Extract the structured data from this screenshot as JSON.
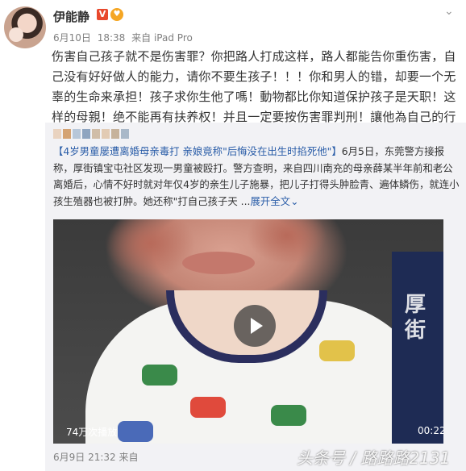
{
  "author": {
    "name": "伊能静",
    "verified_badge": "V",
    "fan_badge_icon": "fan-badge-icon"
  },
  "post_meta": {
    "date": "6月10日",
    "time": "18:38",
    "source": "来自 iPad Pro"
  },
  "post_text": "伤害自己孩子就不是伤害罪？你把路人打成这样，路人都能告你重伤害，自己没有好好做人的能力，请你不要生孩子！！！你和男人的错，却要一个无辜的生命来承担！孩子求你生他了嗎！動物都比你知道保护孩子是天职！这样的母親！绝不能再有扶养权！并且一定要按伤害罪判刑！讓他為自己的行為後悔一輩子！",
  "repost": {
    "headline": "【4岁男童屡遭离婚母亲毒打 亲娘竟称\"后悔没在出生时掐死他\"】",
    "text": "6月5日，东莞警方接报称，厚街镇宝屯社区发现一男童被殴打。警方查明，来自四川南充的母亲薛某半年前和老公离婚后，心情不好时就对年仅4岁的亲生儿子施暴，把儿子打得头肿脸青、遍体鳞伤，就连小孩生殖器也被打肿。她还称\"打自己孩子天 ...",
    "expand_label": "展开全文",
    "expand_icon": "chevron-down-icon",
    "video": {
      "views": "74万次播放",
      "duration": "00:22",
      "sign_text": "厚街",
      "play_icon": "play-icon"
    },
    "meta": {
      "date": "6月9日",
      "time": "21:32",
      "source": "来自"
    }
  },
  "watermark": "头条号 / 路路路2131",
  "colors": {
    "link": "#2a5da8",
    "verified": "#e8482c",
    "card_bg": "#f2f2f5"
  }
}
